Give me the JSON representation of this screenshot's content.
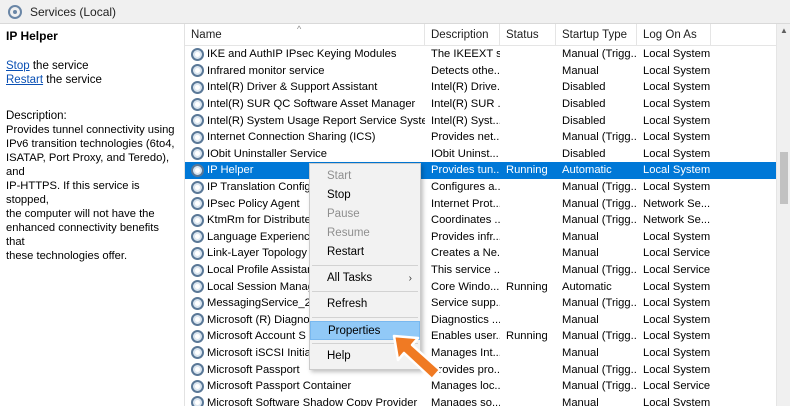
{
  "window": {
    "title": "Services (Local)"
  },
  "left_pane": {
    "service_name": "IP Helper",
    "stop_link": "Stop",
    "stop_suffix": " the service",
    "restart_link": "Restart",
    "restart_suffix": " the service",
    "description_label": "Description:",
    "description_lines": [
      "Provides tunnel connectivity using",
      "IPv6 transition technologies (6to4,",
      "ISATAP, Port Proxy, and Teredo), and",
      "IP-HTTPS. If this service is stopped,",
      "the computer will not have the",
      "enhanced connectivity benefits that",
      "these technologies offer."
    ]
  },
  "table": {
    "headers": [
      "Name",
      "Description",
      "Status",
      "Startup Type",
      "Log On As"
    ],
    "rows": [
      [
        "IKE and AuthIP IPsec Keying Modules",
        "The IKEEXT s...",
        "",
        "Manual (Trigg...",
        "Local System"
      ],
      [
        "Infrared monitor service",
        "Detects othe...",
        "",
        "Manual",
        "Local System"
      ],
      [
        "Intel(R) Driver & Support Assistant",
        "Intel(R) Drive...",
        "",
        "Disabled",
        "Local System"
      ],
      [
        "Intel(R) SUR QC Software Asset Manager",
        "Intel(R) SUR ...",
        "",
        "Disabled",
        "Local System"
      ],
      [
        "Intel(R) System Usage Report Service SystemUs...",
        "Intel(R) Syst...",
        "",
        "Disabled",
        "Local System"
      ],
      [
        "Internet Connection Sharing (ICS)",
        "Provides net...",
        "",
        "Manual (Trigg...",
        "Local System"
      ],
      [
        "IObit Uninstaller Service",
        "IObit Uninst...",
        "",
        "Disabled",
        "Local System"
      ],
      [
        "IP Helper",
        "Provides tun...",
        "Running",
        "Automatic",
        "Local System"
      ],
      [
        "IP Translation Configu",
        "Configures a...",
        "",
        "Manual (Trigg...",
        "Local System"
      ],
      [
        "IPsec Policy Agent",
        "Internet Prot...",
        "",
        "Manual (Trigg...",
        "Network Se..."
      ],
      [
        "KtmRm for Distribute",
        "Coordinates ...",
        "",
        "Manual (Trigg...",
        "Network Se..."
      ],
      [
        "Language Experience",
        "Provides infr...",
        "",
        "Manual",
        "Local System"
      ],
      [
        "Link-Layer Topology",
        "Creates a Ne...",
        "",
        "Manual",
        "Local Service"
      ],
      [
        "Local Profile Assistan",
        "This service ...",
        "",
        "Manual (Trigg...",
        "Local Service"
      ],
      [
        "Local Session Manag",
        "Core Windo...",
        "Running",
        "Automatic",
        "Local System"
      ],
      [
        "MessagingService_2",
        "Service supp...",
        "",
        "Manual (Trigg...",
        "Local System"
      ],
      [
        "Microsoft (R) Diagno",
        "Diagnostics ...",
        "",
        "Manual",
        "Local System"
      ],
      [
        "Microsoft Account S",
        "Enables user...",
        "Running",
        "Manual (Trigg...",
        "Local System"
      ],
      [
        "Microsoft iSCSI Initia",
        "Manages Int...",
        "",
        "Manual",
        "Local System"
      ],
      [
        "Microsoft Passport",
        "Provides pro...",
        "",
        "Manual (Trigg...",
        "Local System"
      ],
      [
        "Microsoft Passport Container",
        "Manages loc...",
        "",
        "Manual (Trigg...",
        "Local Service"
      ],
      [
        "Microsoft Software Shadow Copy Provider",
        "Manages so...",
        "",
        "Manual",
        "Local System"
      ]
    ],
    "selected_index": 7
  },
  "context_menu": {
    "items": [
      {
        "label": "Start",
        "enabled": false
      },
      {
        "label": "Stop",
        "enabled": true
      },
      {
        "label": "Pause",
        "enabled": false
      },
      {
        "label": "Resume",
        "enabled": false
      },
      {
        "label": "Restart",
        "enabled": true
      },
      {
        "label": "All Tasks",
        "enabled": true,
        "submenu_arrow": "›"
      },
      {
        "label": "Refresh",
        "enabled": true
      },
      {
        "label": "Properties",
        "enabled": true,
        "highlighted": true
      },
      {
        "label": "Help",
        "enabled": true
      }
    ]
  },
  "colors": {
    "selection": "#0078d7",
    "menu_highlight": "#91c9f7",
    "link": "#0a50b4",
    "pointer": "#f07a23"
  }
}
